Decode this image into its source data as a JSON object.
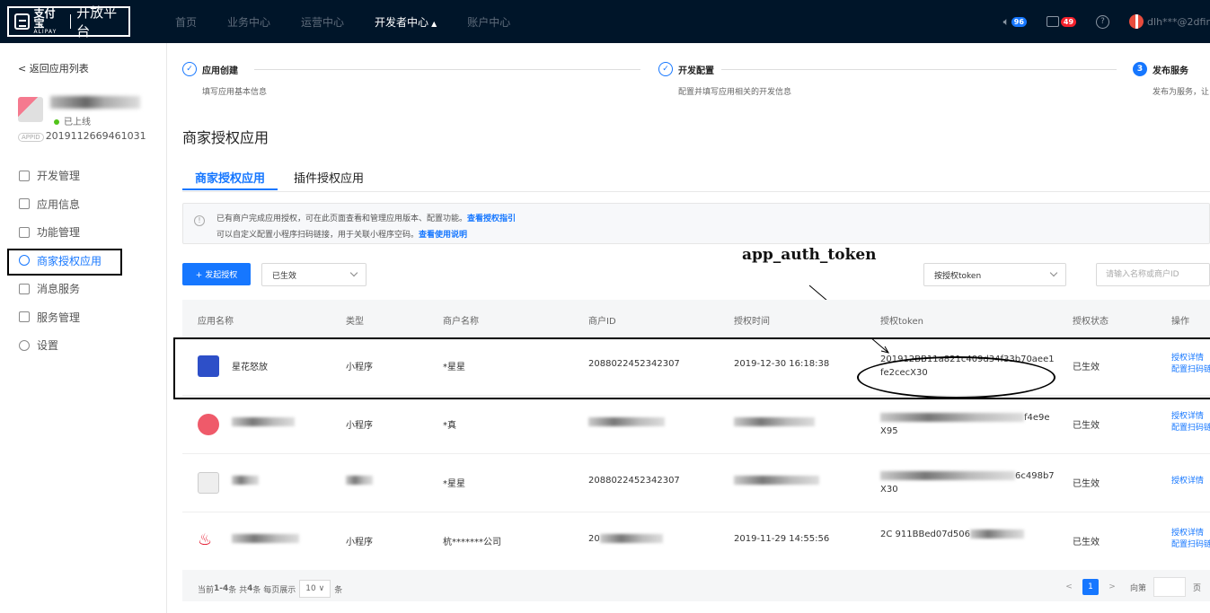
{
  "brand": {
    "cn": "支付宝",
    "en": "ALIPAY",
    "title": "开放平台"
  },
  "nav": [
    {
      "label": "首页"
    },
    {
      "label": "业务中心"
    },
    {
      "label": "运营中心"
    },
    {
      "label": "开发者中心",
      "active": true
    },
    {
      "label": "账户中心"
    }
  ],
  "top_right": {
    "notify_count": "96",
    "tasks_count": "49",
    "help": "?",
    "user": "dlh***@2dfir"
  },
  "sidebar": {
    "back_label": "< 返回应用列表",
    "status": "已上线",
    "appid_tag": "APPID",
    "app_id": "2019112669461031",
    "items": [
      {
        "label": "开发管理",
        "icon": "gear-icon"
      },
      {
        "label": "应用信息",
        "icon": "grid-icon"
      },
      {
        "label": "功能管理",
        "icon": "list-icon"
      },
      {
        "label": "商家授权应用",
        "icon": "user-icon",
        "active": true
      },
      {
        "label": "消息服务",
        "icon": "message-icon"
      },
      {
        "label": "服务管理",
        "icon": "service-icon"
      },
      {
        "label": "设置",
        "icon": "settings-icon"
      }
    ]
  },
  "steps": [
    {
      "num": "✓",
      "title": "应用创建",
      "desc": "填写应用基本信息"
    },
    {
      "num": "✓",
      "title": "开发配置",
      "desc": "配置并填写应用相关的开发信息"
    },
    {
      "num": "3",
      "title": "发布服务",
      "desc": "发布为服务，让"
    }
  ],
  "page_title": "商家授权应用",
  "tabs": [
    "商家授权应用",
    "插件授权应用"
  ],
  "alert": {
    "line1": "已有商户完成应用授权，可在此页面查看和管理应用版本、配置功能。",
    "link1": "查看授权指引",
    "line2": "可以自定义配置小程序扫码链接，用于关联小程序空码。",
    "link2": "查看使用说明"
  },
  "toolbar": {
    "add_label": "+ 发起授权",
    "status_select": "已生效",
    "token_select": "按授权token",
    "search_placeholder": "请输入名称或商户ID"
  },
  "annotation": "app_auth_token",
  "table": {
    "headers": [
      "应用名称",
      "类型",
      "商户名称",
      "商户ID",
      "授权时间",
      "授权token",
      "授权状态",
      "操作"
    ],
    "rows": [
      {
        "name": "星花怒放",
        "type": "小程序",
        "merchant": "*星星",
        "merchant_id": "2088022452342307",
        "time": "2019-12-30 16:18:38",
        "token": "201912BB11a821c409d34f33b70aee1fe2cecX30",
        "status": "已生效",
        "op1": "授权详情",
        "op2": "配置扫码链"
      },
      {
        "name": "",
        "type": "小程序",
        "merchant": "*真",
        "merchant_id": "",
        "time": "",
        "token": "f4e9e",
        "token2": "X95",
        "status": "已生效",
        "op1": "授权详情",
        "op2": "配置扫码链"
      },
      {
        "name": "",
        "type": "",
        "merchant": "*星星",
        "merchant_id": "2088022452342307",
        "time": "",
        "token": "6c498b7",
        "token2": "X30",
        "status": "已生效",
        "op1": "授权详情",
        "op2": ""
      },
      {
        "name": "",
        "type": "小程序",
        "merchant": "杭*******公司",
        "merchant_id": "20",
        "time": "2019-11-29 14:55:56",
        "token": "2C  911BBed07d506",
        "token2": "",
        "status": "已生效",
        "op1": "授权详情",
        "op2": "配置扫码链"
      }
    ]
  },
  "pagination": {
    "summary_pre": "当前",
    "range": "1-4",
    "summary_mid": "条 共",
    "total": "4",
    "summary_post": "条  每页展示",
    "page_size": "10 ∨",
    "unit": "条",
    "current": "1",
    "goto": "向第",
    "page_unit": "页"
  }
}
